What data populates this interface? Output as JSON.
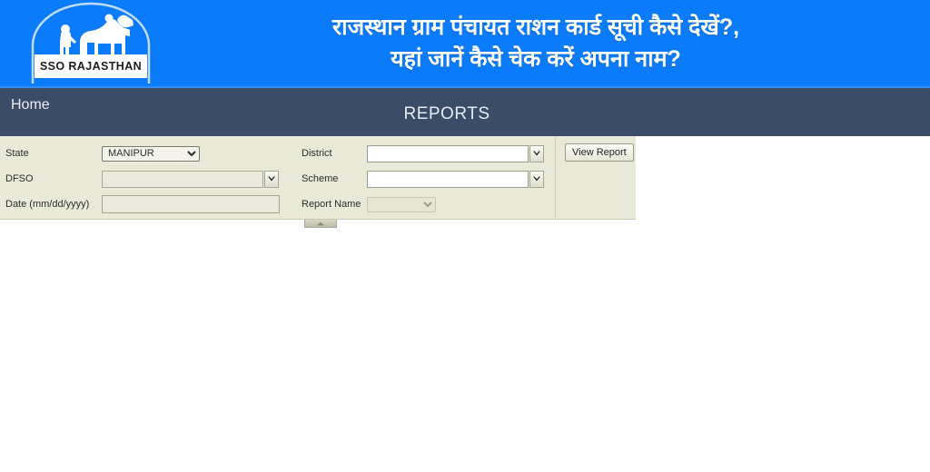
{
  "banner": {
    "logo": {
      "icon": "camel-rider-logo",
      "band_text": "SSO RAJASTHAN"
    },
    "title_line1": "राजस्थान ग्राम पंचायत राशन कार्ड सूची कैसे देखें?,",
    "title_line2": "यहां जानें कैसे चेक करें अपना नाम?",
    "background_color": "#0a7bfb",
    "text_color": "#ffffff"
  },
  "navbar": {
    "home_label": "Home",
    "page_heading": "REPORTS",
    "background_color": "#3a4c68",
    "top_border_color": "#2f8ff5"
  },
  "report_form": {
    "background_color": "#e9e9d7",
    "fields": {
      "state": {
        "label": "State",
        "value": "MANIPUR",
        "options": [
          "MANIPUR"
        ],
        "control": "select",
        "disabled": false
      },
      "dfso": {
        "label": "DFSO",
        "value": "",
        "placeholder": "",
        "control": "combo",
        "disabled": true
      },
      "date": {
        "label": "Date (mm/dd/yyyy)",
        "value": "",
        "placeholder": "",
        "control": "text",
        "disabled": false
      },
      "district": {
        "label": "District",
        "value": "",
        "placeholder": "",
        "control": "combo",
        "disabled": false
      },
      "scheme": {
        "label": "Scheme",
        "value": "",
        "placeholder": "",
        "control": "combo",
        "disabled": false
      },
      "report_name": {
        "label": "Report Name",
        "value": "",
        "options": [],
        "control": "select",
        "disabled": true
      }
    },
    "view_report_label": "View Report",
    "collapse_handle_icon": "chevron-up-icon"
  }
}
